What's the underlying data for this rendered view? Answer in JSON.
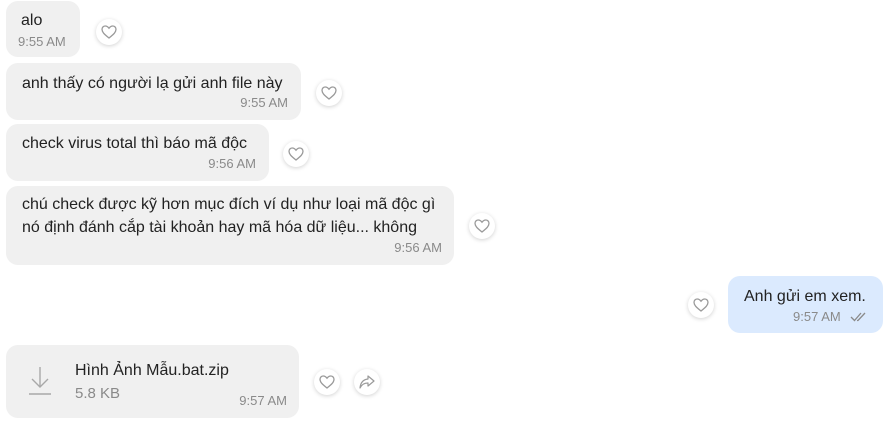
{
  "messages": [
    {
      "text": "alo",
      "time": "9:55 AM",
      "direction": "incoming"
    },
    {
      "text": "anh thấy có người lạ gửi anh file này",
      "time": "9:55 AM",
      "direction": "incoming"
    },
    {
      "text": "check virus total thì báo mã độc",
      "time": "9:56 AM",
      "direction": "incoming"
    },
    {
      "lines": [
        "chú check được kỹ hơn mục đích ví dụ như loại mã độc gì",
        "nó định đánh cắp tài khoản hay mã hóa dữ liệu... không"
      ],
      "time": "9:56 AM",
      "direction": "incoming"
    },
    {
      "text": "Anh gửi em xem.",
      "time": "9:57 AM",
      "direction": "outgoing",
      "status_icon": "double-check-icon"
    }
  ],
  "file_message": {
    "name": "Hình Ảnh Mẫu.bat.zip",
    "size": "5.8 KB",
    "time": "9:57 AM",
    "icon": "download-icon",
    "direction": "incoming"
  },
  "reactions": {
    "icon": "heart-icon",
    "share_icon": "share-icon"
  },
  "colors": {
    "incoming_bubble": "#f0f0f0",
    "outgoing_bubble": "#dbeafe",
    "time_text": "#8a8a8a"
  }
}
